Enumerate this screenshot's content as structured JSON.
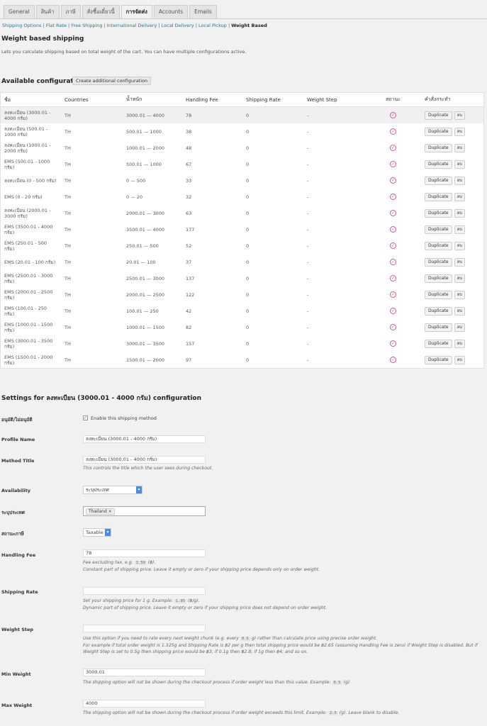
{
  "tabs": [
    {
      "label": "General"
    },
    {
      "label": "สินค้า"
    },
    {
      "label": "ภาษี"
    },
    {
      "label": "สั่งซื้อเดี๋ยวนี้"
    },
    {
      "label": "การจัดส่ง"
    },
    {
      "label": "Accounts"
    },
    {
      "label": "Emails"
    }
  ],
  "subnav": {
    "items": [
      "Shipping Options",
      "Flat Rate",
      "Free Shipping",
      "International Delivery",
      "Local Delivery",
      "Local Pickup"
    ],
    "current": "Weight Based",
    "sep": "|"
  },
  "page": {
    "title": "Weight based shipping",
    "description": "Lets you calculate shipping based on total weight of the cart. You can have multiple configurations active.",
    "available_title": "Available configurations",
    "create_button": "Create additional configuration"
  },
  "table": {
    "headers": [
      "ชื่อ",
      "Countries",
      "น้ำหนัก",
      "Handling Fee",
      "Shipping Rate",
      "Weight Step",
      "สถานะ",
      "คำสั่งกระทำ"
    ],
    "duplicate_label": "Duplicate",
    "delete_label": "ลบ",
    "status_icon": "check-circle-icon",
    "rows": [
      {
        "name": "ลงทะเบียน (3000.01 - 4000 กรัม)",
        "country": "TH",
        "weight": "3000.01 — 4000",
        "fee": "78",
        "rate": "0",
        "step": "-"
      },
      {
        "name": "ลงทะเบียน (500.01 - 1000 กรัม)",
        "country": "TH",
        "weight": "500.01 — 1000",
        "fee": "38",
        "rate": "0",
        "step": "-"
      },
      {
        "name": "ลงทะเบียน (1000.01 - 2000 กรัม)",
        "country": "TH",
        "weight": "1000.01 — 2000",
        "fee": "48",
        "rate": "0",
        "step": "-"
      },
      {
        "name": "EMS (500.01 - 1000 กรัม)",
        "country": "TH",
        "weight": "500.01 — 1000",
        "fee": "67",
        "rate": "0",
        "step": "-"
      },
      {
        "name": "ลงทะเบียน (0 - 500 กรัม)",
        "country": "TH",
        "weight": "0 — 500",
        "fee": "33",
        "rate": "0",
        "step": "-"
      },
      {
        "name": "EMS (0 - 20 กรัม)",
        "country": "TH",
        "weight": "0 — 20",
        "fee": "32",
        "rate": "0",
        "step": "-"
      },
      {
        "name": "ลงทะเบียน (2000.01 - 3000 กรัม)",
        "country": "TH",
        "weight": "2000.01 — 3000",
        "fee": "63",
        "rate": "0",
        "step": "-"
      },
      {
        "name": "EMS (3500.01 - 4000 กรัม)",
        "country": "TH",
        "weight": "3500.01 — 4000",
        "fee": "177",
        "rate": "0",
        "step": "-"
      },
      {
        "name": "EMS (250.01 - 500 กรัม)",
        "country": "TH",
        "weight": "250.01 — 500",
        "fee": "52",
        "rate": "0",
        "step": "-"
      },
      {
        "name": "EMS (20.01 - 100 กรัม)",
        "country": "TH",
        "weight": "20.01 — 100",
        "fee": "37",
        "rate": "0",
        "step": "-"
      },
      {
        "name": "EMS (2500.01 - 3000 กรัม)",
        "country": "TH",
        "weight": "2500.01 — 3000",
        "fee": "137",
        "rate": "0",
        "step": "-"
      },
      {
        "name": "EMS (2000.01 - 2500 กรัม)",
        "country": "TH",
        "weight": "2000.01 — 2500",
        "fee": "122",
        "rate": "0",
        "step": "-"
      },
      {
        "name": "EMS (100.01 - 250 กรัม)",
        "country": "TH",
        "weight": "100.01 — 250",
        "fee": "42",
        "rate": "0",
        "step": "-"
      },
      {
        "name": "EMS (1000.01 - 1500 กรัม)",
        "country": "TH",
        "weight": "1000.01 — 1500",
        "fee": "82",
        "rate": "0",
        "step": "-"
      },
      {
        "name": "EMS (3000.01 - 3500 กรัม)",
        "country": "TH",
        "weight": "3000.01 — 3500",
        "fee": "157",
        "rate": "0",
        "step": "-"
      },
      {
        "name": "EMS (1500.01 - 2000 กรัม)",
        "country": "TH",
        "weight": "1500.01 — 2000",
        "fee": "97",
        "rate": "0",
        "step": "-"
      }
    ]
  },
  "settings": {
    "title": "Settings for ลงทะเบียน (3000.01 - 4000 กรัม) configuration",
    "enable_label": "อนุมัติ/ไม่อนุมัติ",
    "enable_text": "Enable this shipping method",
    "profile_label": "Profile Name",
    "profile_value": "ลงทะเบียน (3000.01 - 4000 กรัม)",
    "method_label": "Method Title",
    "method_value": "ลงทะเบียน (3000.01 - 4000 กรัม)",
    "method_help": "This controls the title which the user sees during checkout.",
    "availability_label": "Availability",
    "availability_value": "ระบุประเทศ",
    "countries_label": "ระบุประเทศ",
    "country_token": "Thailand",
    "tax_label": "สถานะภาษี",
    "tax_value": "Taxable",
    "fee_label": "Handling Fee",
    "fee_value": "78",
    "fee_help_1a": "Fee excluding tax, e.g.",
    "fee_help_1code": "3.50",
    "fee_help_1b": "(฿).",
    "fee_help_2": "Constant part of shipping price. Leave it empty or zero if your shipping price depends only on order weight.",
    "rate_label": "Shipping Rate",
    "rate_value": "",
    "rate_help_1a": "Set your shipping price for 1 g. Example:",
    "rate_help_1code": "1.95",
    "rate_help_1b": "(฿/g).",
    "rate_help_2": "Dynamic part of shipping price. Leave it empty or zero if your shipping price does not depend on order weight.",
    "step_label": "Weight Step",
    "step_value": "",
    "step_help_1a": "Use this option if you need to rate every next weight chunk (e.g. every",
    "step_help_1code": "0.5",
    "step_help_1b": "g) rather than calculate price using precise order weight.",
    "step_help_2": "For example if total order weight is 1.325g and Shipping Rate is ฿2 per g then total shipping price would be ฿2.65 (assuming Handling Fee is zero) if Weight Step is disabled. But if",
    "step_help_3": "Weight Step is set to 0.5g then shipping price would be ฿3; if 0.1g then ฿2.8; if 1g then ฿4; and so on.",
    "min_label": "Min Weight",
    "min_value": "3000.01",
    "min_help_a": "The shipping option will not be shown during the checkout process if order weight less than this value. Example:",
    "min_help_code": "0.5",
    "min_help_b": "(g).",
    "max_label": "Max Weight",
    "max_value": "4000",
    "max_help_a": "The shipping option will not be shown during the checkout process if order weight exceeds this limit. Example:",
    "max_help_code": "2.5",
    "max_help_b": "(g). Leave blank to disable."
  }
}
